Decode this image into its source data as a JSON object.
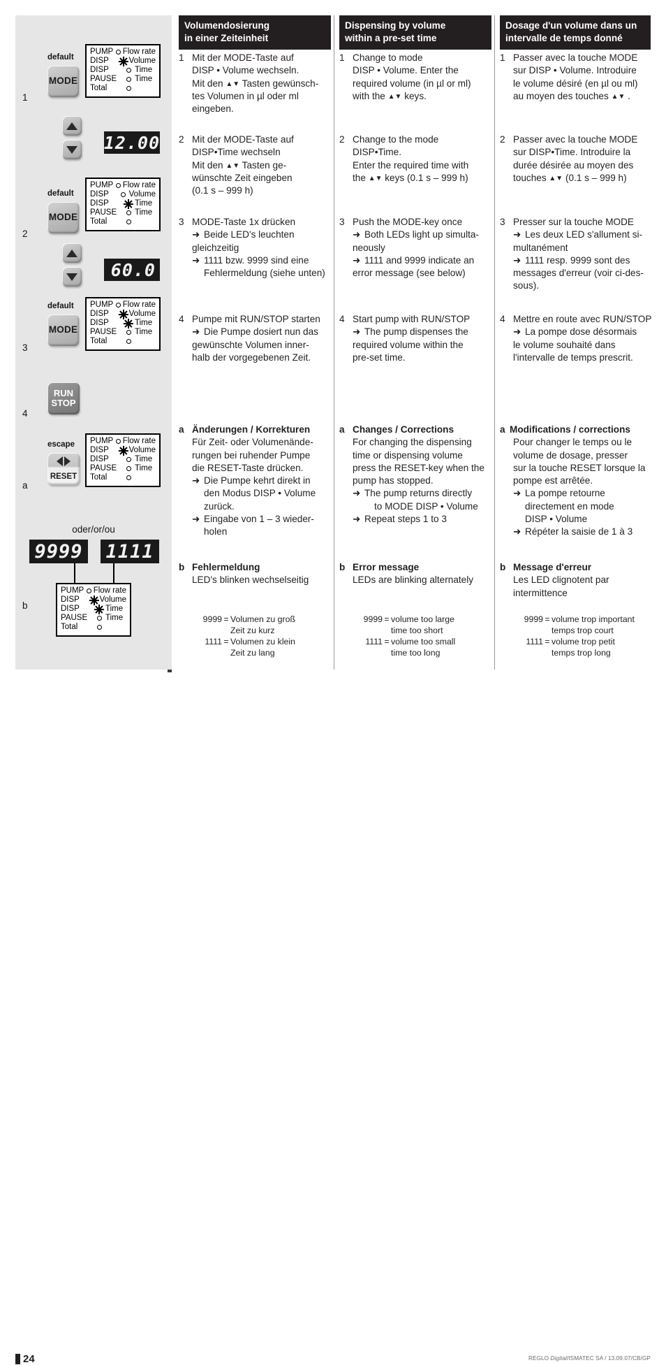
{
  "page": {
    "number": "24",
    "credit_prefix": "REGLO ",
    "credit_italic": "Digital",
    "credit_suffix": "/ISMATEC SA / 13.09.07/CB/GP"
  },
  "illustration": {
    "or_label": "oder/or/ou",
    "keys": {
      "mode": "MODE",
      "run": "RUN",
      "stop": "STOP",
      "reset": "RESET"
    },
    "captions": {
      "default": "default",
      "escape": "escape"
    },
    "step_numbers": {
      "one": "1",
      "two": "2",
      "three": "3",
      "four": "4",
      "a": "a",
      "b": "b"
    },
    "displays": {
      "volume": "12.00",
      "time": "60.0",
      "error_high": "9999",
      "error_low": "1111"
    },
    "led_labels": {
      "pump": "PUMP",
      "disp": "DISP",
      "pause": "PAUSE",
      "total": "Total",
      "flow_rate": "Flow rate",
      "volume": "Volume",
      "time": "Time"
    },
    "led_panels": [
      {
        "name": "panel-step-1",
        "states": [
          "off",
          "on",
          "off",
          "off",
          "off"
        ]
      },
      {
        "name": "panel-step-2",
        "states": [
          "off",
          "off",
          "on",
          "off",
          "off"
        ]
      },
      {
        "name": "panel-step-3",
        "states": [
          "off",
          "on",
          "on",
          "off",
          "off"
        ]
      },
      {
        "name": "panel-step-a",
        "states": [
          "off",
          "on",
          "off",
          "off",
          "off"
        ]
      },
      {
        "name": "panel-step-b",
        "states": [
          "off",
          "on",
          "on",
          "off",
          "off"
        ]
      }
    ]
  },
  "columns": {
    "de": {
      "heading_line1": "Volumendosierung",
      "heading_line2": "in einer Zeiteinheit",
      "step1_marker": "1",
      "step1_l1": "Mit der MODE-Taste auf",
      "step1_l2": "DISP • Volume wechseln.",
      "step1_l3a": "Mit den ",
      "step1_l3b": " Tasten gewünsch-",
      "step1_l4": "tes Volumen in µl oder ml",
      "step1_l5": "eingeben.",
      "step2_marker": "2",
      "step2_l1": "Mit der MODE-Taste auf",
      "step2_l2": "DISP•Time wechseln",
      "step2_l3a": "Mit den ",
      "step2_l3b": " Tasten ge-",
      "step2_l4": "wünschte Zeit eingeben",
      "step2_l5": "(0.1 s – 999 h)",
      "step3_marker": "3",
      "step3_l1": "MODE-Taste 1x drücken",
      "step3_a1": "Beide LED's leuchten",
      "step3_l2": "gleichzeitig",
      "step3_a2": "1111 bzw. 9999 sind eine",
      "step3_a2b": "Fehlermeldung (siehe unten)",
      "step4_marker": "4",
      "step4_l1": "Pumpe mit RUN/STOP starten",
      "step4_a1": "Die Pumpe dosiert nun das",
      "step4_l2": "gewünschte Volumen inner-",
      "step4_l3": "halb der vorgegebenen Zeit.",
      "a_marker": "a",
      "a_title": "Änderungen / Korrekturen",
      "a_l1": "Für Zeit- oder Volumenände-",
      "a_l2": "rungen bei ruhender Pumpe",
      "a_l3": "die RESET-Taste drücken.",
      "a_a1": "Die Pumpe kehrt direkt in",
      "a_a1b": "den Modus DISP • Volume",
      "a_a1c": "zurück.",
      "a_a2": "Eingabe von 1 – 3 wieder-",
      "a_a2b": "holen",
      "b_marker": "b",
      "b_title": "Fehlermeldung",
      "b_l1": "LED's blinken wechselseitig",
      "err_code_high": "9999",
      "err_eq": "=",
      "err_high_l1": "Volumen zu groß",
      "err_high_l2": "Zeit zu kurz",
      "err_code_low": "1111",
      "err_low_l1": "Volumen zu klein",
      "err_low_l2": "Zeit zu lang"
    },
    "en": {
      "heading_line1": "Dispensing by volume",
      "heading_line2": "within a pre-set time",
      "step1_marker": "1",
      "step1_l1": "Change to mode",
      "step1_l2": "DISP • Volume. Enter the",
      "step1_l3": "required volume (in µl or ml)",
      "step1_l4a": "with the ",
      "step1_l4b": " keys.",
      "step2_marker": "2",
      "step2_l1": "Change to the mode",
      "step2_l2": "DISP•Time.",
      "step2_l3": "Enter the required time with",
      "step2_l4a": "the ",
      "step2_l4b": " keys (0.1 s – 999 h)",
      "step3_marker": "3",
      "step3_l1": "Push the MODE-key once",
      "step3_a1": "Both LEDs light up simulta-",
      "step3_l2": "neously",
      "step3_a2": "1111 and 9999 indicate an",
      "step3_l3": "error message (see below)",
      "step4_marker": "4",
      "step4_l1": "Start pump with RUN/STOP",
      "step4_a1": "The pump dispenses the",
      "step4_l2": "required volume within the",
      "step4_l3": "pre-set time.",
      "a_marker": "a",
      "a_title": "Changes / Corrections",
      "a_l1": "For changing the dispensing",
      "a_l2": "time or dispensing volume",
      "a_l3": "press the RESET-key when the",
      "a_l4": "pump has stopped.",
      "a_a1": "The pump returns directly",
      "a_a1b": "to MODE DISP • Volume",
      "a_a2": "Repeat steps 1 to 3",
      "b_marker": "b",
      "b_title": "Error message",
      "b_l1": "LEDs are blinking alternately",
      "err_code_high": "9999",
      "err_eq": "=",
      "err_high_l1": "volume too large",
      "err_high_l2": "time too short",
      "err_code_low": "1111",
      "err_low_l1": "volume too small",
      "err_low_l2": "time too long"
    },
    "fr": {
      "heading_line1": "Dosage d'un volume dans un",
      "heading_line2": "intervalle de temps donné",
      "step1_marker": "1",
      "step1_l1": "Passer avec la touche MODE",
      "step1_l2": "sur DISP • Volume. Introduire",
      "step1_l3": "le volume désiré (en µl ou ml)",
      "step1_l4a": "au moyen des touches ",
      "step1_l4b": " .",
      "step2_marker": "2",
      "step2_l1": "Passer avec la touche MODE",
      "step2_l2": "sur DISP•Time. Introduire la",
      "step2_l3": "durée désirée au moyen des",
      "step2_l4a": "touches ",
      "step2_l4b": "  (0.1 s – 999 h)",
      "step3_marker": "3",
      "step3_l1": "Presser sur la touche MODE",
      "step3_a1": "Les deux LED s'allument si-",
      "step3_l2": "multanément",
      "step3_a2": "1111 resp. 9999 sont des",
      "step3_l3": "messages d'erreur (voir ci-des-",
      "step3_l4": "sous).",
      "step4_marker": "4",
      "step4_l1": "Mettre en route avec RUN/STOP",
      "step4_a1": "La pompe dose désormais",
      "step4_l2": "le volume souhaité dans",
      "step4_l3": "l'intervalle de temps prescrit.",
      "a_marker": "a",
      "a_title": "Modifications / corrections",
      "a_l1": "Pour changer le temps ou le",
      "a_l2": "volume de dosage, presser",
      "a_l3": "sur la touche RESET lorsque la",
      "a_l4": "pompe est arrêtée.",
      "a_a1": "La pompe retourne",
      "a_a1b": "directement en mode",
      "a_a1c": "DISP • Volume",
      "a_a2": "Répéter la saisie de 1 à 3",
      "b_marker": "b",
      "b_title": "Message d'erreur",
      "b_l1": "Les LED clignotent par",
      "b_l2": "intermittence",
      "err_code_high": "9999",
      "err_eq": "=",
      "err_high_l1": "volume trop important",
      "err_high_l2": "temps trop court",
      "err_code_low": "1111",
      "err_low_l1": " volume trop petit",
      "err_low_l2": "temps trop long"
    }
  }
}
